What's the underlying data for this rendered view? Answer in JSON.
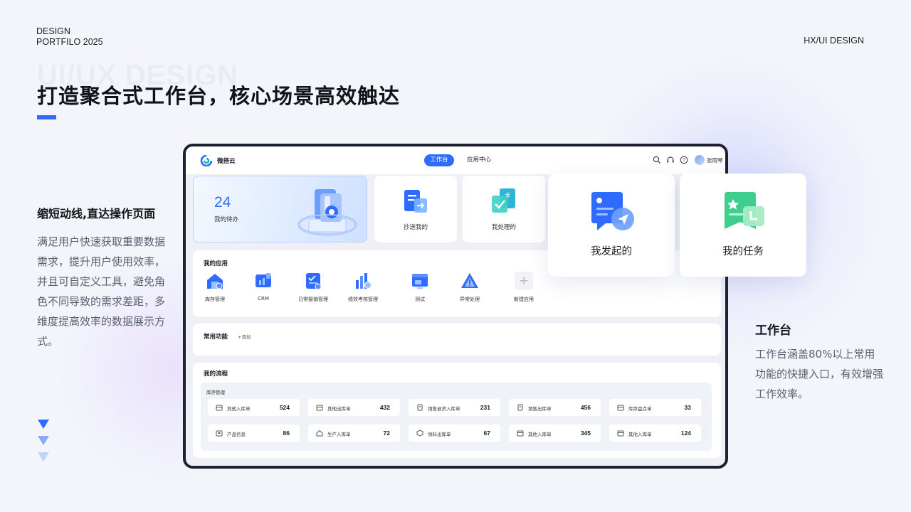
{
  "page": {
    "brand_left_line1": "DESIGN",
    "brand_left_line2": "PORTFILO 2025",
    "brand_right": "HX/UI DESIGN",
    "watermark": "UI/UX DESIGN",
    "title": "打造聚合式工作台，核心场景高效触达",
    "accent_color": "#2f6bff"
  },
  "left_panel": {
    "heading": "缩短动线,直达操作页面",
    "description": "满足用户快速获取重要数据需求，提升用户使用效率，并且可自定义工具，避免角色不同导致的需求差距，多维度提高效率的数据展示方式。"
  },
  "right_panel": {
    "heading": "工作台",
    "description": "工作台涵盖80%以上常用功能的快捷入口，有效增强工作效率。"
  },
  "app": {
    "logo_text": "微搭云",
    "tabs": [
      {
        "label": "工作台",
        "active": true
      },
      {
        "label": "应用中心",
        "active": false
      }
    ],
    "toolbar_icons": [
      "search-icon",
      "headset-icon",
      "help-icon"
    ],
    "user_name": "张雨琴",
    "hero": {
      "count": "24",
      "label": "我的待办"
    },
    "quick_cards": [
      {
        "label": "抄送我的",
        "icon": "cc-document-icon"
      },
      {
        "label": "我处理的",
        "icon": "processed-check-icon"
      }
    ],
    "floating_cards": [
      {
        "label": "我发起的",
        "icon": "send-message-icon"
      },
      {
        "label": "我的任务",
        "icon": "task-star-icon"
      }
    ],
    "my_apps": {
      "title": "我的应用",
      "items": [
        {
          "label": "库存管理",
          "icon": "warehouse-icon"
        },
        {
          "label": "CRM",
          "icon": "crm-icon"
        },
        {
          "label": "日常报销管理",
          "icon": "reimbursement-icon"
        },
        {
          "label": "绩效考核管理",
          "icon": "performance-chart-icon"
        },
        {
          "label": "测试",
          "icon": "test-screen-icon"
        },
        {
          "label": "异常处理",
          "icon": "warning-icon"
        },
        {
          "label": "新建应用",
          "icon": "plus-icon"
        }
      ]
    },
    "common_functions": {
      "title": "常用功能",
      "add_label": "+添加"
    },
    "my_flows": {
      "title": "我的流程",
      "group": "库存管理",
      "items": [
        {
          "label": "其他入库单",
          "count": "524",
          "icon": "inbound-icon"
        },
        {
          "label": "其他出库单",
          "count": "432",
          "icon": "outbound-icon"
        },
        {
          "label": "销售退货入库单",
          "count": "231",
          "icon": "return-icon"
        },
        {
          "label": "销售出库单",
          "count": "456",
          "icon": "sales-out-icon"
        },
        {
          "label": "库存盘点单",
          "count": "33",
          "icon": "stocktake-icon"
        },
        {
          "label": "产品信息",
          "count": "86",
          "icon": "product-info-icon"
        },
        {
          "label": "生产入库单",
          "count": "72",
          "icon": "production-in-icon"
        },
        {
          "label": "领料出库单",
          "count": "67",
          "icon": "material-out-icon"
        },
        {
          "label": "其他入库单",
          "count": "345",
          "icon": "inbound-icon"
        },
        {
          "label": "其他入库单",
          "count": "124",
          "icon": "inbound-icon"
        }
      ]
    }
  }
}
